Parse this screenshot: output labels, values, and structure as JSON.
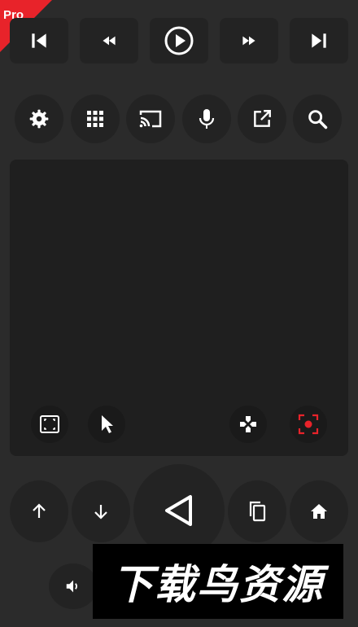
{
  "badge": {
    "label": "Pro",
    "color": "#e8232a"
  },
  "media_controls": [
    {
      "name": "skip-previous-icon"
    },
    {
      "name": "rewind-icon"
    },
    {
      "name": "play-icon"
    },
    {
      "name": "fast-forward-icon"
    },
    {
      "name": "skip-next-icon"
    }
  ],
  "quick_actions": [
    {
      "name": "settings-icon"
    },
    {
      "name": "apps-grid-icon"
    },
    {
      "name": "cast-icon"
    },
    {
      "name": "microphone-icon"
    },
    {
      "name": "open-external-icon"
    },
    {
      "name": "search-icon"
    }
  ],
  "touchpad": {
    "tools": [
      {
        "name": "fullscreen-icon"
      },
      {
        "name": "pointer-icon"
      },
      {
        "name": "gamepad-icon"
      },
      {
        "name": "screen-record-icon",
        "color": "#e8232a"
      }
    ]
  },
  "nav_controls": [
    {
      "name": "arrow-up-icon"
    },
    {
      "name": "arrow-down-icon"
    },
    {
      "name": "back-triangle-icon"
    },
    {
      "name": "copy-icon"
    },
    {
      "name": "home-icon"
    },
    {
      "name": "volume-icon"
    }
  ],
  "watermark": {
    "text": "下载鸟资源"
  }
}
